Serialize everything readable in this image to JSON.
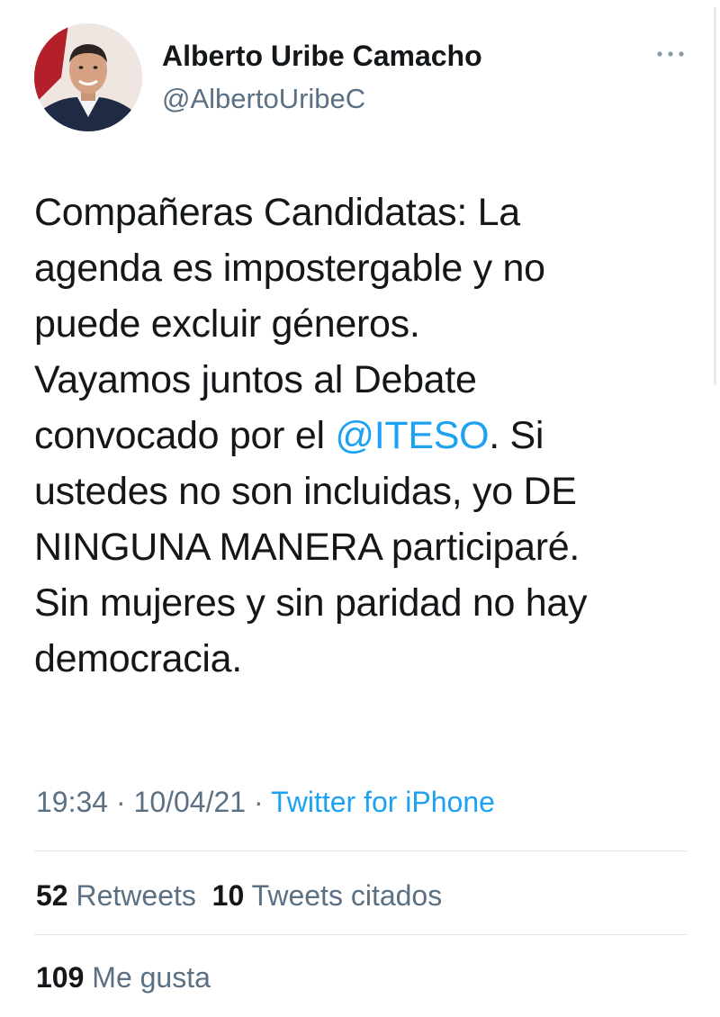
{
  "author": {
    "display_name": "Alberto Uribe Camacho",
    "handle": "@AlbertoUribeC"
  },
  "tweet": {
    "lines": [
      "Compañeras Candidatas: La",
      "agenda es impostergable y no",
      "puede excluir géneros.",
      "Vayamos juntos al Debate"
    ],
    "line5_prefix": "convocado por el ",
    "mention": "@ITESO",
    "line5_suffix": ". Si",
    "lines_after": [
      "ustedes no son incluidas, yo DE",
      "NINGUNA MANERA participaré.",
      "Sin mujeres y sin paridad no hay",
      "democracia."
    ]
  },
  "meta": {
    "time": "19:34",
    "separator": " · ",
    "date": "10/04/21",
    "source": "Twitter for iPhone"
  },
  "stats": {
    "retweets_count": "52",
    "retweets_label": "Retweets",
    "quotes_count": "10",
    "quotes_label": "Tweets citados",
    "likes_count": "109",
    "likes_label": "Me gusta"
  },
  "icons": {
    "more": "more-horizontal-icon"
  },
  "colors": {
    "link": "#1da1f2",
    "secondary_text": "#5b7083",
    "primary_text": "#14171a",
    "divider": "#dfe3e6"
  }
}
